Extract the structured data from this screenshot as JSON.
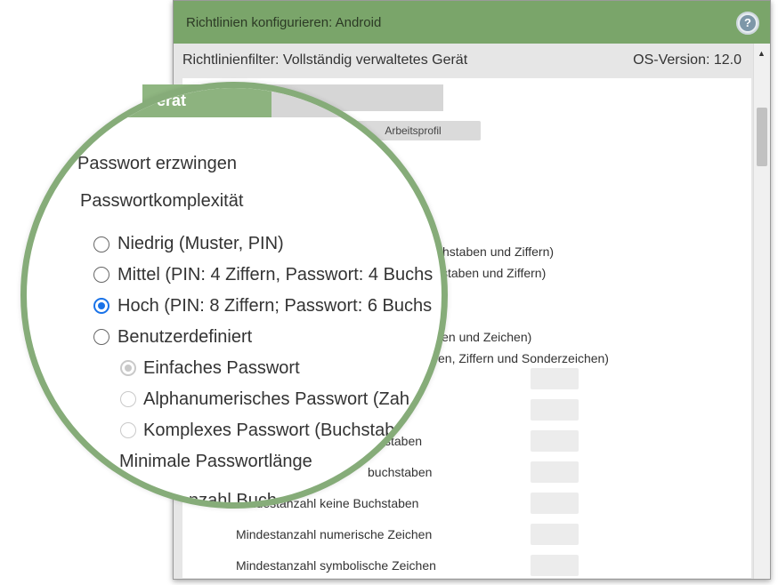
{
  "window": {
    "title": "Richtlinien konfigurieren: Android",
    "help_icon": "?"
  },
  "filterbar": {
    "filter_label": "Richtlinienfilter: Vollständig verwaltetes Gerät",
    "os_version": "OS-Version: 12.0"
  },
  "tabs": {
    "device_label": "erät",
    "work_profile_label": "Arbeitsprofil"
  },
  "background_text": [
    "chstaben und Ziffern)",
    "staben und Ziffern)",
    "len und Zeichen)",
    "en, Ziffern und Sonderzeichen)",
    "staben",
    "buchstaben",
    "Mindestanzahl keine Buchstaben",
    "Mindestanzahl numerische Zeichen",
    "Mindestanzahl symbolische Zeichen"
  ],
  "magnifier": {
    "enforce_password": "Passwort erzwingen",
    "complexity_heading": "Passwortkomplexität",
    "options": [
      {
        "label": "Niedrig (Muster, PIN)",
        "checked": false
      },
      {
        "label": "Mittel (PIN: 4 Ziffern, Passwort: 4 Buchs",
        "checked": false
      },
      {
        "label": "Hoch (PIN: 8 Ziffern; Passwort: 6 Buchs",
        "checked": true
      },
      {
        "label": "Benutzerdefiniert",
        "checked": false
      }
    ],
    "sub_options": [
      {
        "label": "Einfaches Passwort",
        "checked": true
      },
      {
        "label": "Alphanumerisches Passwort (Zah",
        "checked": false
      },
      {
        "label": "Komplexes Passwort (Buchstab",
        "checked": false
      }
    ],
    "min_length_label": "Minimale Passwortlänge",
    "partial_bottom": "nzahl Buch"
  },
  "colors": {
    "titlebar": "#7aa56a",
    "magnifier_ring": "#86ac79",
    "radio_selected": "#1a73e8"
  }
}
